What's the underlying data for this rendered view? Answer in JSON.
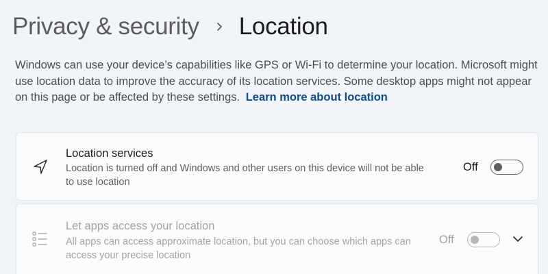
{
  "breadcrumb": {
    "parent": "Privacy & security",
    "current": "Location"
  },
  "description": {
    "text": "Windows can use your device’s capabilities like GPS or Wi-Fi to determine your location. Microsoft might use location data to improve the accuracy of its location services. Some desktop apps might not appear on this page or be affected by these settings.",
    "link_label": "Learn more about location"
  },
  "settings": [
    {
      "title": "Location services",
      "description": "Location is turned off and Windows and other users on this device will not be able to use location",
      "state_label": "Off",
      "enabled": true,
      "toggled_on": false,
      "icon": "location-arrow-icon"
    },
    {
      "title": "Let apps access your location",
      "description": "All apps can access approximate location, but you can choose which apps can access your precise location",
      "state_label": "Off",
      "enabled": false,
      "toggled_on": false,
      "icon": "app-list-icon",
      "expandable": true
    }
  ],
  "colors": {
    "link": "#0f4b8f",
    "background": "#f1f4f8",
    "card": "#fbfcfd"
  }
}
